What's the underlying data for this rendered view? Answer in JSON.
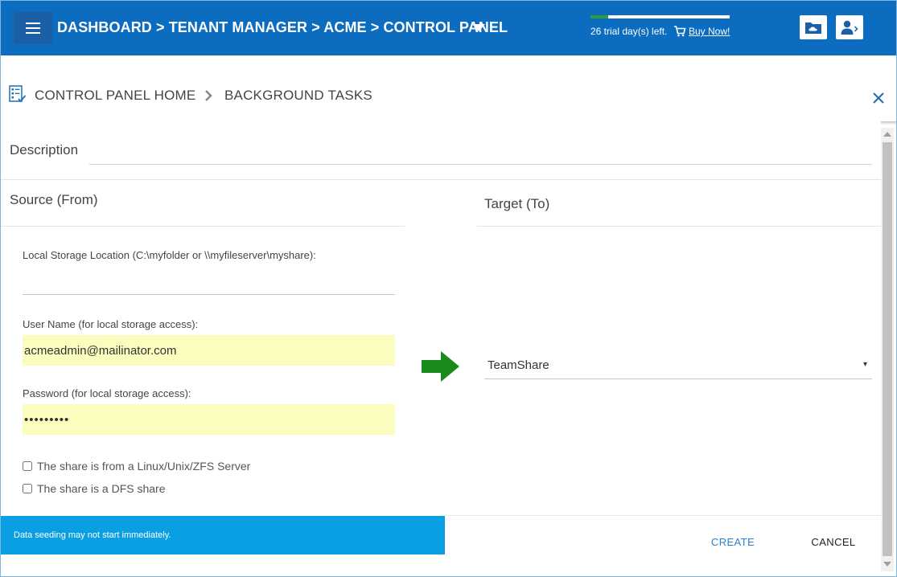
{
  "header": {
    "breadcrumb_title": "DASHBOARD > TENANT MANAGER > ACME > CONTROL PANEL",
    "trial_text": "26 trial day(s) left.",
    "trial_progress": 0.13,
    "buy_link": "Buy Now!",
    "icons": [
      "menu-icon",
      "chevron-down-icon",
      "cart-icon",
      "cloud-folder-icon",
      "user-switch-icon"
    ]
  },
  "page_header": {
    "home_label": "CONTROL PANEL HOME",
    "tasks_label": "BACKGROUND TASKS"
  },
  "form": {
    "description_label": "Description",
    "description_value": "",
    "source_title": "Source (From)",
    "target_title": "Target (To)",
    "local_storage_label": "Local Storage Location (C:\\myfolder or \\\\myfileserver\\myshare):",
    "local_storage_value": "",
    "username_label": "User Name (for local storage access):",
    "username_value": "acmeadmin@mailinator.com",
    "password_label": "Password (for local storage access):",
    "password_value": "•••••••••",
    "checkbox_linux_label": "The share is from a Linux/Unix/ZFS Server",
    "checkbox_linux_checked": false,
    "checkbox_dfs_label": "The share is a DFS share",
    "checkbox_dfs_checked": false,
    "target_selected": "TeamShare",
    "target_caret": "▾"
  },
  "footer": {
    "notice": "Data seeding may not start immediately.",
    "create_label": "CREATE",
    "cancel_label": "CANCEL"
  },
  "colors": {
    "topbar": "#0c6cbf",
    "notice": "#0a9ee3",
    "input_highlight": "#fafdbe",
    "arrow": "#1a8a1a",
    "create": "#2a7fd0"
  }
}
